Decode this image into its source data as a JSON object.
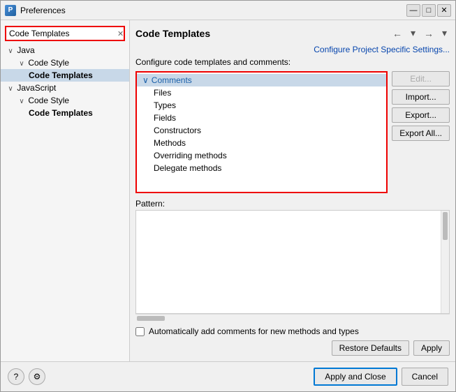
{
  "window": {
    "title": "Preferences",
    "icon": "P"
  },
  "titlebar": {
    "minimize": "—",
    "maximize": "□",
    "close": "✕"
  },
  "sidebar": {
    "search_placeholder": "Code Templates",
    "items": [
      {
        "id": "java",
        "label": "Java",
        "level": 1,
        "expand": "∨",
        "bold": false
      },
      {
        "id": "java-codestyle",
        "label": "Code Style",
        "level": 2,
        "expand": "∨",
        "bold": false
      },
      {
        "id": "java-codetemplates",
        "label": "Code Templates",
        "level": 3,
        "expand": "",
        "bold": true
      },
      {
        "id": "javascript",
        "label": "JavaScript",
        "level": 1,
        "expand": "∨",
        "bold": false
      },
      {
        "id": "js-codestyle",
        "label": "Code Style",
        "level": 2,
        "expand": "∨",
        "bold": false
      },
      {
        "id": "js-codetemplates",
        "label": "Code Templates",
        "level": 3,
        "expand": "",
        "bold": true
      }
    ]
  },
  "main": {
    "title": "Code Templates",
    "configure_link": "Configure Project Specific Settings...",
    "description": "Configure code templates and comments:",
    "nav_back": "←",
    "nav_forward": "→",
    "nav_dropdown": "▾",
    "tree": {
      "items": [
        {
          "id": "comments",
          "label": "Comments",
          "type": "parent",
          "expanded": true
        },
        {
          "id": "files",
          "label": "Files",
          "type": "child"
        },
        {
          "id": "types",
          "label": "Types",
          "type": "child"
        },
        {
          "id": "fields",
          "label": "Fields",
          "type": "child"
        },
        {
          "id": "constructors",
          "label": "Constructors",
          "type": "child"
        },
        {
          "id": "methods",
          "label": "Methods",
          "type": "child"
        },
        {
          "id": "overriding-methods",
          "label": "Overriding methods",
          "type": "child"
        },
        {
          "id": "delegate-methods",
          "label": "Delegate methods",
          "type": "child"
        }
      ]
    },
    "buttons": {
      "edit": "Edit...",
      "import": "Import...",
      "export": "Export...",
      "export_all": "Export All..."
    },
    "pattern": {
      "label": "Pattern:"
    },
    "auto_comments": {
      "label": "Automatically add comments for new methods and types",
      "checked": false
    },
    "restore_defaults": "Restore Defaults",
    "apply": "Apply"
  },
  "footer": {
    "help_icon": "?",
    "settings_icon": "⚙",
    "apply_close": "Apply and Close",
    "cancel": "Cancel"
  }
}
